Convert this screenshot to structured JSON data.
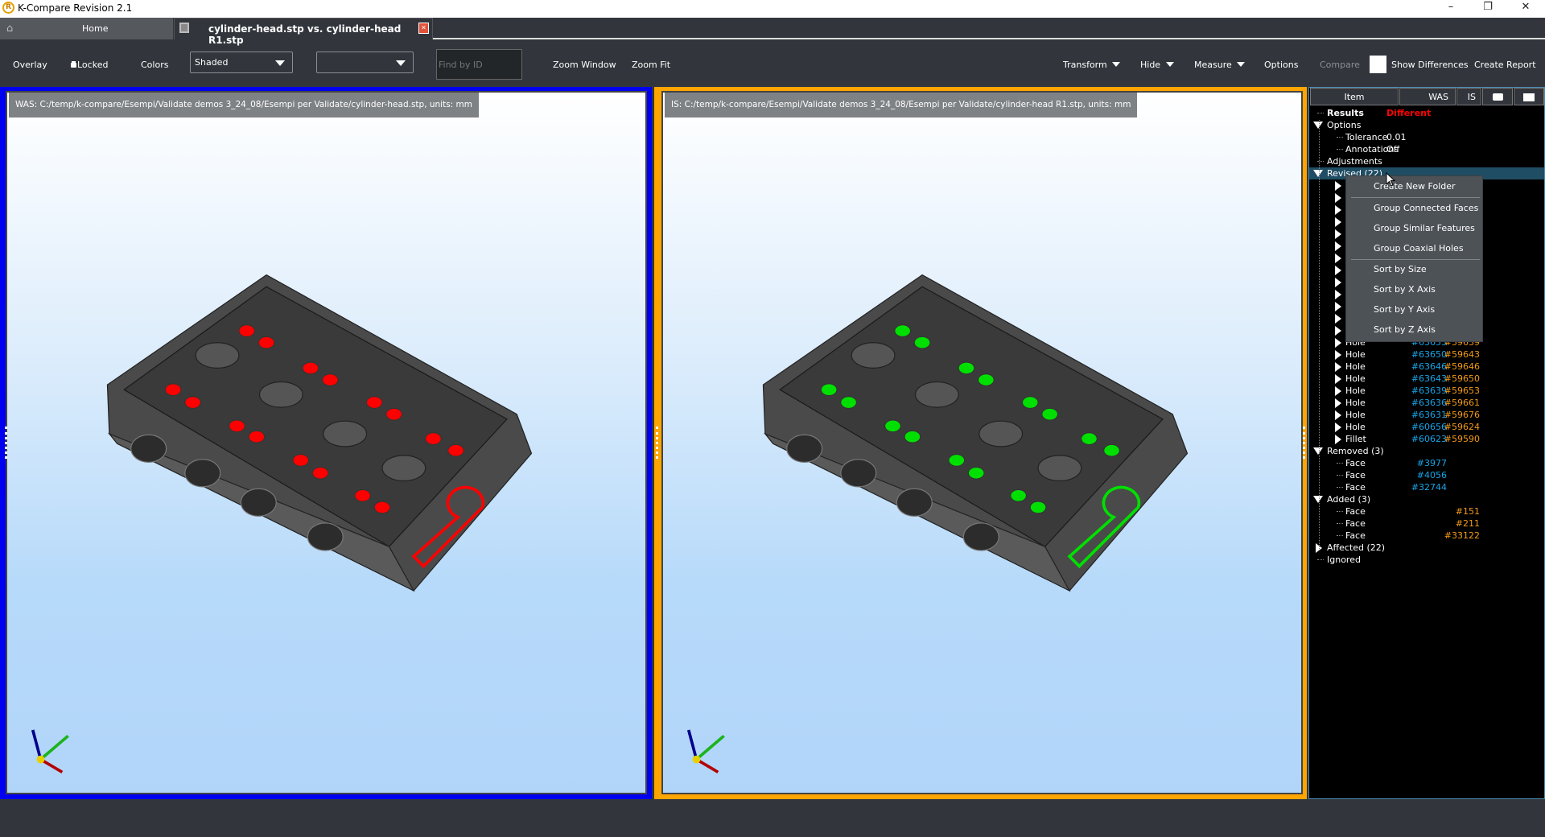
{
  "window": {
    "title": "K-Compare Revision 2.1",
    "minimize": "–",
    "restore": "❐",
    "close": "✕"
  },
  "tabs": [
    {
      "label": "Home",
      "icon": "home-icon"
    },
    {
      "label": "cylinder-head.stp vs. cylinder-head R1.stp",
      "icon": "model-icon",
      "close": "✕"
    }
  ],
  "toolbar": {
    "overlay": "Overlay",
    "locked": "Locked",
    "colors": "Colors",
    "display_mode": "Shaded",
    "second_select": "",
    "find_placeholder": "Find by ID",
    "zoom_window": "Zoom Window",
    "zoom_fit": "Zoom Fit",
    "transform": "Transform",
    "hide": "Hide",
    "measure": "Measure",
    "options": "Options",
    "compare": "Compare",
    "show_differences": "Show Differences",
    "show_differences_checked": false,
    "create_report": "Create Report"
  },
  "viewports": {
    "was": {
      "label": "WAS:  C:/temp/k-compare/Esempi/Validate demos 3_24_08/Esempi per Validate/cylinder-head.stp, units: mm",
      "border_color": "#0000ff",
      "highlight_color": "#ff0000"
    },
    "is": {
      "label": "IS:  C:/temp/k-compare/Esempi/Validate demos 3_24_08/Esempi per Validate/cylinder-head R1.stp, units: mm",
      "border_color": "#ffa500",
      "highlight_color": "#00e000"
    }
  },
  "panel": {
    "headers": {
      "item": "Item",
      "was": "WAS",
      "is": "IS",
      "camera": "camera-icon",
      "folder": "folder-icon"
    },
    "results_label": "Results",
    "results_value": "Different",
    "options_label": "Options",
    "tolerance_label": "Tolerance",
    "tolerance_value": "0.01",
    "annotations_label": "Annotations",
    "annotations_value": "Off",
    "adjustments_label": "Adjustments",
    "revised_label": "Revised (22)",
    "revised_items": [
      {
        "label": "",
        "was": "",
        "is": ""
      },
      {
        "label": "",
        "was": "",
        "is": ""
      },
      {
        "label": "",
        "was": "",
        "is": ""
      },
      {
        "label": "",
        "was": "",
        "is": ""
      },
      {
        "label": "",
        "was": "",
        "is": ""
      },
      {
        "label": "",
        "was": "",
        "is": ""
      },
      {
        "label": "",
        "was": "",
        "is": ""
      },
      {
        "label": "",
        "was": "",
        "is": ""
      },
      {
        "label": "",
        "was": "",
        "is": ""
      },
      {
        "label": "",
        "was": "",
        "is": ""
      },
      {
        "label": "",
        "was": "",
        "is": ""
      },
      {
        "label": "",
        "was": "",
        "is": ""
      },
      {
        "label": "",
        "was": "",
        "is": ""
      },
      {
        "label": "Hole",
        "was": "#63653",
        "is": "#59639"
      },
      {
        "label": "Hole",
        "was": "#63650",
        "is": "#59643"
      },
      {
        "label": "Hole",
        "was": "#63646",
        "is": "#59646"
      },
      {
        "label": "Hole",
        "was": "#63643",
        "is": "#59650"
      },
      {
        "label": "Hole",
        "was": "#63639",
        "is": "#59653"
      },
      {
        "label": "Hole",
        "was": "#63636",
        "is": "#59661"
      },
      {
        "label": "Hole",
        "was": "#63631",
        "is": "#59676"
      },
      {
        "label": "Hole",
        "was": "#60656",
        "is": "#59624"
      },
      {
        "label": "Fillet",
        "was": "#60623",
        "is": "#59590"
      }
    ],
    "removed_label": "Removed (3)",
    "removed_items": [
      {
        "label": "Face",
        "was": "#3977",
        "is": ""
      },
      {
        "label": "Face",
        "was": "#4056",
        "is": ""
      },
      {
        "label": "Face",
        "was": "#32744",
        "is": ""
      }
    ],
    "added_label": "Added (3)",
    "added_items": [
      {
        "label": "Face",
        "was": "",
        "is": "#151"
      },
      {
        "label": "Face",
        "was": "",
        "is": "#211"
      },
      {
        "label": "Face",
        "was": "",
        "is": "#33122"
      }
    ],
    "affected_label": "Affected (22)",
    "ignored_label": "Ignored"
  },
  "context_menu": {
    "items": [
      "Create New Folder",
      "Group Connected Faces",
      "Group Similar Features",
      "Group Coaxial Holes",
      "Sort by Size",
      "Sort by X Axis",
      "Sort by Y Axis",
      "Sort by Z Axis"
    ]
  },
  "colors": {
    "was_id": "#19a5e8",
    "is_id": "#f29a16",
    "different": "#ff0000",
    "selection": "#1f4d63"
  }
}
